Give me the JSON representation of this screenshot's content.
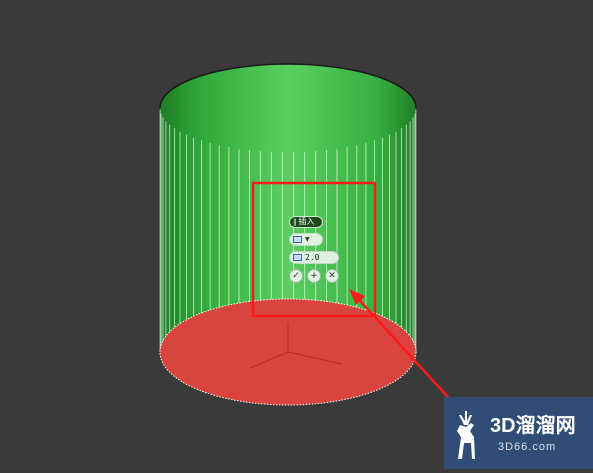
{
  "caddy": {
    "title": "插入",
    "grip_glyph": "‖",
    "dropdown_icon": "square-icon",
    "value_icon": "square-icon",
    "value": "2.0",
    "actions": [
      {
        "icon": "check-icon",
        "glyph": "✓"
      },
      {
        "icon": "plus-icon",
        "glyph": "+"
      },
      {
        "icon": "close-icon",
        "glyph": "✕"
      }
    ]
  },
  "watermark": {
    "line1": "3D溜溜网",
    "line2": "3D66.com"
  },
  "colors": {
    "background": "#3a3a3a",
    "cylinder_green": "#3fb84a",
    "selected_face_red": "#d9443f",
    "highlight_box": "#ff1a1a",
    "watermark_bg": "#2f4d75"
  }
}
